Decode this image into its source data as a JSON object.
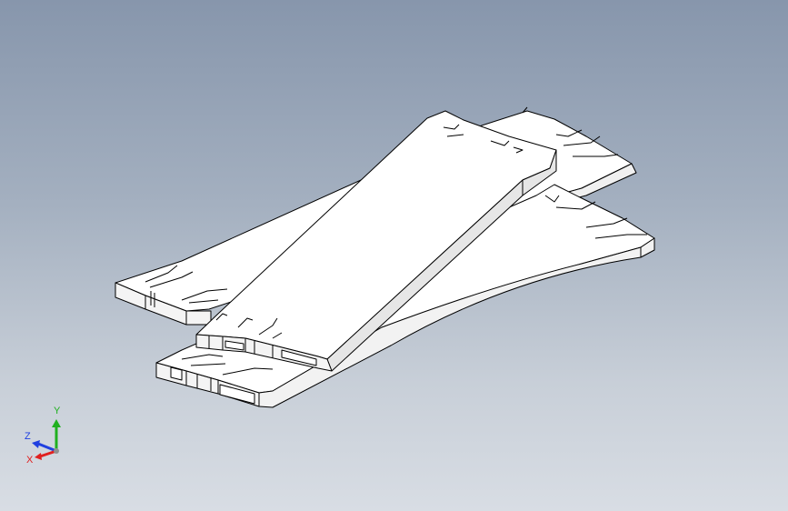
{
  "viewport": {
    "background_top": "#8796ac",
    "background_bottom": "#d8dde4"
  },
  "model": {
    "face_color": "#ffffff",
    "edge_color": "#000000",
    "shade_color": "#e6e6e6"
  },
  "triad": {
    "x_label": "X",
    "y_label": "Y",
    "z_label": "Z",
    "x_color": "#e02020",
    "y_color": "#20b020",
    "z_color": "#2040e0"
  }
}
